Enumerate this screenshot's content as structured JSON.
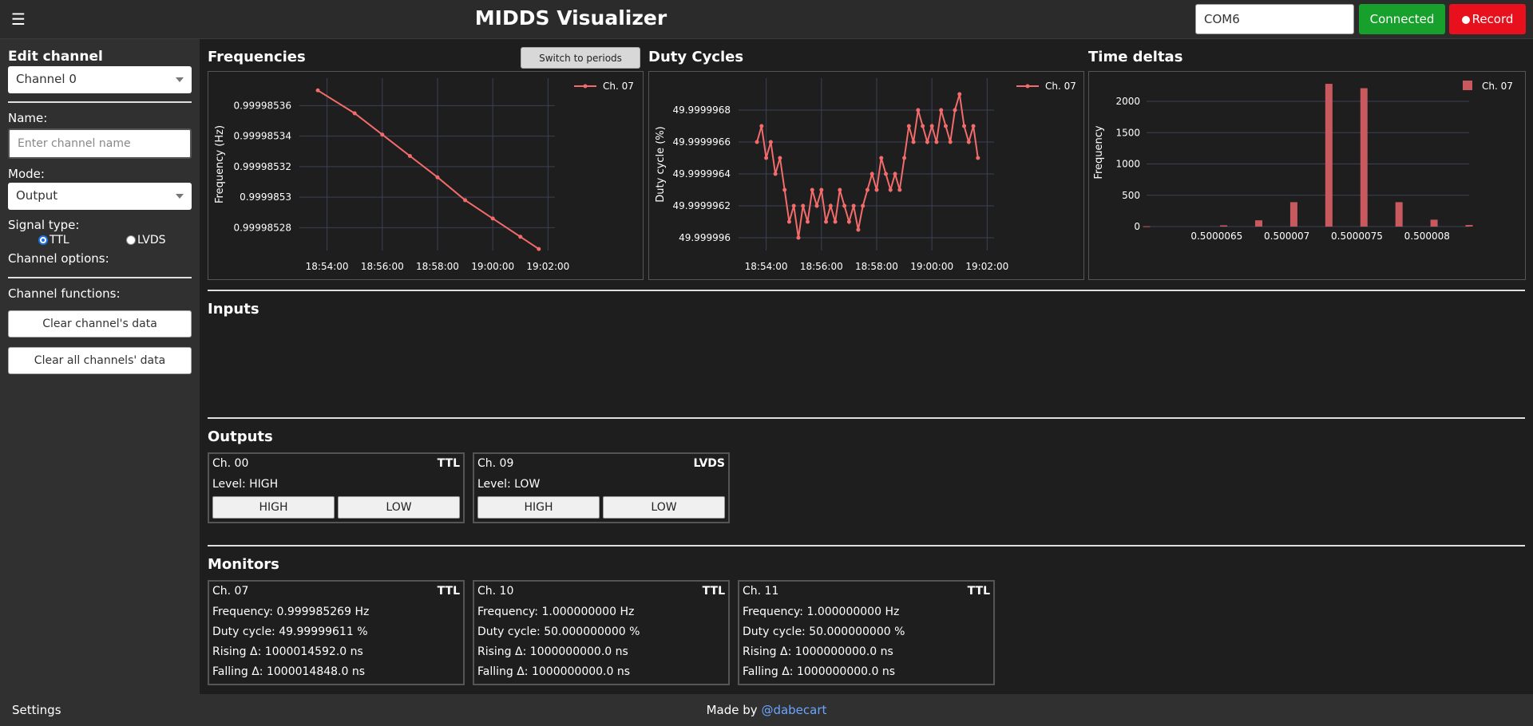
{
  "header": {
    "title": "MIDDS Visualizer",
    "port_value": "COM6",
    "connected_label": "Connected",
    "record_label": "Record"
  },
  "sidebar": {
    "title": "Edit channel",
    "channel_select": "Channel 0",
    "name_label": "Name:",
    "name_placeholder": "Enter channel name",
    "mode_label": "Mode:",
    "mode_select": "Output",
    "signal_label": "Signal type:",
    "signal_options": [
      "TTL",
      "LVDS"
    ],
    "signal_selected": "TTL",
    "channel_options_label": "Channel options:",
    "channel_functions_label": "Channel functions:",
    "clear_channel_label": "Clear channel's data",
    "clear_all_label": "Clear all channels' data"
  },
  "footer": {
    "settings_label": "Settings",
    "made_by_prefix": "Made by ",
    "made_by_link": "@dabecart"
  },
  "panels": {
    "frequencies_title": "Frequencies",
    "switch_label": "Switch to periods",
    "duty_title": "Duty Cycles",
    "deltas_title": "Time deltas"
  },
  "chart_data": [
    {
      "type": "line",
      "ylabel": "Frequency (Hz)",
      "legend": "Ch. 07",
      "legend_position": "top-right",
      "x_ticks": [
        "18:54:00",
        "18:56:00",
        "18:58:00",
        "19:00:00",
        "19:02:00"
      ],
      "x_range": [
        "18:53:00",
        "19:02:15"
      ],
      "y_ticks": [
        0.99998528,
        0.9999853,
        0.99998532,
        0.99998534,
        0.99998536
      ],
      "y_tick_labels": [
        "0.99998528",
        "0.9999853",
        "0.99998532",
        "0.99998534",
        "0.99998536"
      ],
      "ylim": [
        0.999985265,
        0.999985378
      ],
      "series": [
        {
          "name": "Ch. 07",
          "color": "#f46b6b",
          "x": [
            "18:53:40",
            "18:55:00",
            "18:56:00",
            "18:57:00",
            "18:58:00",
            "18:59:00",
            "19:00:00",
            "19:01:00",
            "19:01:40"
          ],
          "y": [
            0.99998537,
            0.999985355,
            0.999985341,
            0.999985327,
            0.999985313,
            0.999985298,
            0.999985286,
            0.999985274,
            0.999985266
          ]
        }
      ]
    },
    {
      "type": "line",
      "ylabel": "Duty cycle (%)",
      "legend": "Ch. 07",
      "legend_position": "top-right",
      "x_ticks": [
        "18:54:00",
        "18:56:00",
        "18:58:00",
        "19:00:00",
        "19:02:00"
      ],
      "x_range": [
        "18:53:00",
        "19:02:15"
      ],
      "y_ticks": [
        49.999996,
        49.9999962,
        49.9999964,
        49.9999966,
        49.9999968
      ],
      "y_tick_labels": [
        "49.999996",
        "49.9999962",
        "49.9999964",
        "49.9999966",
        "49.9999968"
      ],
      "ylim": [
        49.99999592,
        49.999997
      ],
      "series": [
        {
          "name": "Ch. 07",
          "color": "#f46b6b",
          "x": [
            "18:53:40",
            "18:53:50",
            "18:54:00",
            "18:54:10",
            "18:54:20",
            "18:54:30",
            "18:54:40",
            "18:54:50",
            "18:55:00",
            "18:55:10",
            "18:55:20",
            "18:55:30",
            "18:55:40",
            "18:55:50",
            "18:56:00",
            "18:56:10",
            "18:56:20",
            "18:56:30",
            "18:56:40",
            "18:56:50",
            "18:57:00",
            "18:57:10",
            "18:57:20",
            "18:57:30",
            "18:57:40",
            "18:57:50",
            "18:58:00",
            "18:58:10",
            "18:58:20",
            "18:58:30",
            "18:58:40",
            "18:58:50",
            "18:59:00",
            "18:59:10",
            "18:59:20",
            "18:59:30",
            "18:59:40",
            "18:59:50",
            "19:00:00",
            "19:00:10",
            "19:00:20",
            "19:00:30",
            "19:00:40",
            "19:00:50",
            "19:01:00",
            "19:01:10",
            "19:01:20",
            "19:01:30",
            "19:01:40"
          ],
          "y": [
            49.9999966,
            49.9999967,
            49.9999965,
            49.9999966,
            49.9999964,
            49.9999965,
            49.9999963,
            49.9999961,
            49.9999962,
            49.999996,
            49.9999962,
            49.9999961,
            49.9999963,
            49.9999962,
            49.9999963,
            49.9999961,
            49.9999962,
            49.9999961,
            49.9999963,
            49.9999962,
            49.9999961,
            49.9999962,
            49.99999605,
            49.9999962,
            49.9999963,
            49.9999964,
            49.9999963,
            49.9999965,
            49.9999964,
            49.9999963,
            49.9999964,
            49.9999963,
            49.9999965,
            49.9999967,
            49.9999966,
            49.9999968,
            49.9999967,
            49.9999966,
            49.9999967,
            49.9999966,
            49.9999968,
            49.9999967,
            49.9999966,
            49.9999968,
            49.9999969,
            49.9999967,
            49.9999966,
            49.9999967,
            49.9999965
          ]
        }
      ]
    },
    {
      "type": "bar",
      "ylabel": "Frequency",
      "legend": "Ch. 07",
      "legend_position": "top-right",
      "x_ticks": [
        0.5000065,
        0.500007,
        0.5000075,
        0.500008
      ],
      "x_tick_labels": [
        "0.5000065",
        "0.500007",
        "0.5000075",
        "0.500008"
      ],
      "x_range": [
        0.500006,
        0.5000083
      ],
      "y_ticks": [
        0,
        500,
        1000,
        1500,
        2000
      ],
      "ylim": [
        0,
        2370
      ],
      "series": [
        {
          "name": "Ch. 07",
          "color": "#c8595f",
          "x": [
            0.500006,
            0.50000655,
            0.5000068,
            0.50000705,
            0.5000073,
            0.50000755,
            0.5000078,
            0.50000805,
            0.5000083
          ],
          "y": [
            5,
            20,
            100,
            390,
            2280,
            2210,
            390,
            110,
            25
          ]
        }
      ]
    }
  ],
  "inputs": {
    "title": "Inputs"
  },
  "outputs": {
    "title": "Outputs",
    "cards": [
      {
        "channel": "Ch. 00",
        "type": "TTL",
        "level": "Level: HIGH",
        "high_label": "HIGH",
        "low_label": "LOW"
      },
      {
        "channel": "Ch. 09",
        "type": "LVDS",
        "level": "Level: LOW",
        "high_label": "HIGH",
        "low_label": "LOW"
      }
    ]
  },
  "monitors": {
    "title": "Monitors",
    "cards": [
      {
        "channel": "Ch. 07",
        "type": "TTL",
        "frequency": "Frequency: 0.999985269 Hz",
        "duty": "Duty cycle: 49.99999611 %",
        "rising": "Rising Δ: 1000014592.0 ns",
        "falling": "Falling Δ: 1000014848.0 ns"
      },
      {
        "channel": "Ch. 10",
        "type": "TTL",
        "frequency": "Frequency: 1.000000000 Hz",
        "duty": "Duty cycle: 50.000000000 %",
        "rising": "Rising Δ: 1000000000.0 ns",
        "falling": "Falling Δ: 1000000000.0 ns"
      },
      {
        "channel": "Ch. 11",
        "type": "TTL",
        "frequency": "Frequency: 1.000000000 Hz",
        "duty": "Duty cycle: 50.000000000 %",
        "rising": "Rising Δ: 1000000000.0 ns",
        "falling": "Falling Δ: 1000000000.0 ns"
      }
    ]
  }
}
